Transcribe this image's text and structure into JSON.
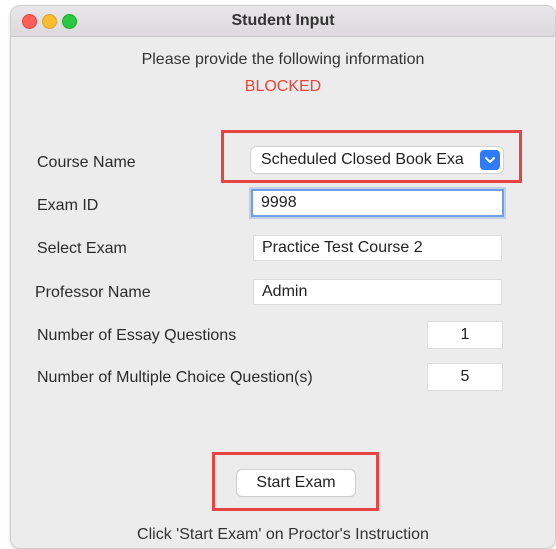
{
  "window": {
    "title": "Student Input"
  },
  "info_text": "Please provide the following information",
  "status_text": "BLOCKED",
  "form": {
    "course_name": {
      "label": "Course Name",
      "value": "Scheduled Closed Book Exa"
    },
    "exam_id": {
      "label": "Exam ID",
      "value": "9998"
    },
    "select_exam": {
      "label": "Select Exam",
      "value": "Practice Test Course 2"
    },
    "professor_name": {
      "label": "Professor Name",
      "value": "Admin"
    },
    "essay_questions": {
      "label": "Number of Essay Questions",
      "value": "1"
    },
    "mc_questions": {
      "label": "Number of Multiple Choice Question(s)",
      "value": "5"
    }
  },
  "start_button": {
    "label": "Start Exam"
  },
  "instruction_text": "Click 'Start Exam' on Proctor's Instruction",
  "colors": {
    "status": "#e8463a",
    "highlight": "#e54545",
    "accent": "#2f7bf5"
  }
}
